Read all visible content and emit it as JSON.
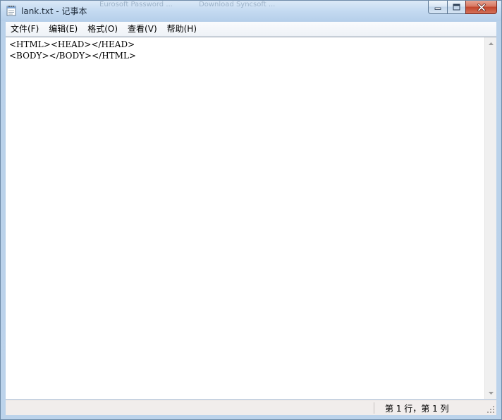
{
  "window": {
    "title": "lank.txt - 记事本",
    "background_tabs": [
      "",
      "Eurosoft Password ...",
      "Download Syncsoft ...",
      ""
    ]
  },
  "menu": {
    "items": [
      {
        "label": "文件(F)"
      },
      {
        "label": "编辑(E)"
      },
      {
        "label": "格式(O)"
      },
      {
        "label": "查看(V)"
      },
      {
        "label": "帮助(H)"
      }
    ]
  },
  "editor": {
    "lines": [
      "<HTML><HEAD></HEAD>",
      "<BODY></BODY></HTML>"
    ]
  },
  "statusbar": {
    "position": "第 1 行，第 1 列"
  },
  "colors": {
    "frame": "#bcd3eb",
    "close_button": "#c2442b",
    "editor_bg": "#ffffff",
    "status_bg": "#f1edec"
  }
}
